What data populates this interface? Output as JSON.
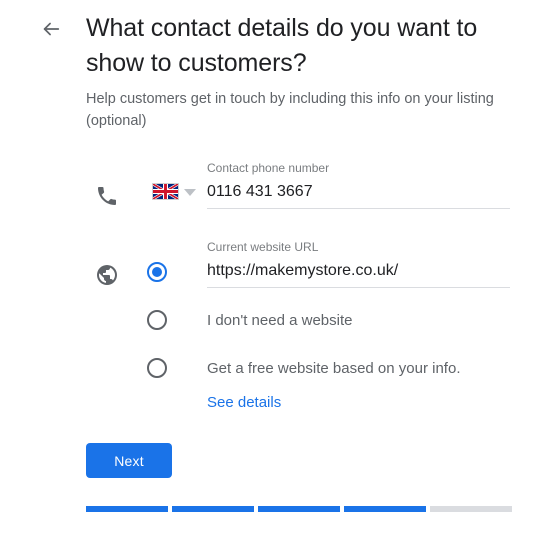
{
  "header": {
    "back_icon": "arrow-left-icon",
    "title": "What contact details do you want to show to customers?",
    "subtitle": "Help customers get in touch by including this info on your listing (optional)"
  },
  "phone_row": {
    "icon": "phone-icon",
    "country_flag": "uk-flag-icon",
    "country_dropdown_icon": "chevron-down-icon",
    "label": "Contact phone number",
    "value": "0116 431 3667",
    "placeholder": "Contact phone number"
  },
  "website_section": {
    "icon": "globe-icon",
    "options": [
      {
        "id": "current-website",
        "selected": true,
        "label": "Current website URL",
        "value": "https://makemystore.co.uk/",
        "placeholder": "Current website URL"
      },
      {
        "id": "no-website",
        "selected": false,
        "label": "I don't need a website"
      },
      {
        "id": "free-website",
        "selected": false,
        "label": "Get a free website based on your info.",
        "link_label": "See details"
      }
    ]
  },
  "actions": {
    "next_label": "Next"
  },
  "progress": {
    "total_steps": 5,
    "completed_steps": 4
  },
  "colors": {
    "accent": "#1a73e8",
    "text_primary": "#202124",
    "text_secondary": "#5f6368",
    "divider": "#dadce0"
  }
}
